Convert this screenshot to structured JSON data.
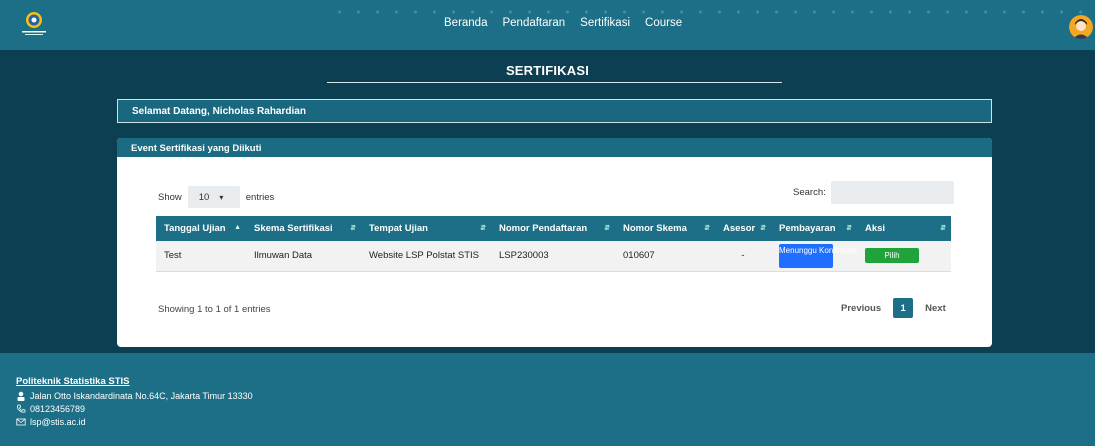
{
  "nav": {
    "links": [
      "Beranda",
      "Pendaftaran",
      "Sertifikasi",
      "Course"
    ]
  },
  "page": {
    "title": "SERTIFIKASI",
    "welcome": "Selamat Datang, Nicholas Rahardian"
  },
  "card": {
    "header": "Event Sertifikasi yang Diikuti",
    "show_label": "Show",
    "entries_value": "10",
    "entries_label": "entries",
    "search_label": "Search:",
    "search_value": "",
    "columns": [
      "Tanggal Ujian",
      "Skema Sertifikasi",
      "Tempat Ujian",
      "Nomor Pendaftaran",
      "Nomor Skema",
      "Asesor",
      "Pembayaran",
      "Aksi"
    ],
    "rows": [
      {
        "tanggal": "Test",
        "skema": "Ilmuwan Data",
        "tempat": "Website LSP Polstat STIS",
        "nomor_pendaftaran": "LSP230003",
        "nomor_skema": "010607",
        "asesor": "-",
        "pembayaran": "Menunggu Konfirmasi",
        "aksi": "Pilih"
      }
    ],
    "info": "Showing 1 to 1 of 1 entries",
    "pager": {
      "prev": "Previous",
      "page": "1",
      "next": "Next"
    }
  },
  "footer": {
    "name": "Politeknik Statistika STIS",
    "address": "Jalan Otto Iskandardinata No.64C, Jakarta Timur 13330",
    "phone": "08123456789",
    "email": "lsp@stis.ac.id"
  },
  "colors": {
    "navbar": "#1c6f86",
    "background": "#0d3f52",
    "waiting_button": "#1e6fff",
    "pick_button": "#1fa33a"
  }
}
